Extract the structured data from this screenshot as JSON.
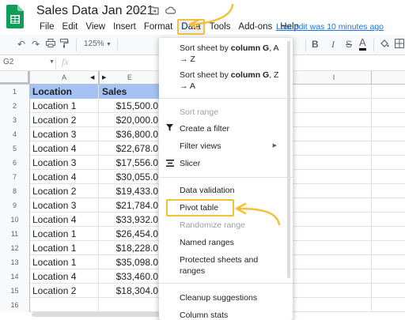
{
  "app": {
    "doc_title": "Sales Data Jan 2021",
    "last_edit": "Last edit was 10 minutes ago",
    "title_icons": [
      "star-icon",
      "move-to-folder-icon",
      "cloud-status-icon"
    ]
  },
  "menubar": {
    "items": [
      "File",
      "Edit",
      "View",
      "Insert",
      "Format",
      "Data",
      "Tools",
      "Add-ons",
      "Help"
    ],
    "active": "Data"
  },
  "toolbar": {
    "zoom": "125%",
    "bold": "B",
    "italic": "I",
    "strike": "S",
    "text_color": "A"
  },
  "formula_bar": {
    "name_box": "G2",
    "fx": "fx"
  },
  "grid": {
    "columns": [
      "A",
      "E",
      "I"
    ],
    "row_numbers": [
      "1",
      "2",
      "3",
      "4",
      "5",
      "6",
      "7",
      "8",
      "9",
      "10",
      "11",
      "12",
      "13",
      "14",
      "15",
      "16"
    ],
    "header": {
      "a": "Location",
      "e": "Sales"
    },
    "rows": [
      {
        "a": "Location 1",
        "e": "$15,500.0"
      },
      {
        "a": "Location 2",
        "e": "$20,000.0"
      },
      {
        "a": "Location 3",
        "e": "$36,800.0"
      },
      {
        "a": "Location 4",
        "e": "$22,678.0"
      },
      {
        "a": "Location 3",
        "e": "$17,556.0"
      },
      {
        "a": "Location 4",
        "e": "$30,055.0"
      },
      {
        "a": "Location 2",
        "e": "$19,433.0"
      },
      {
        "a": "Location 3",
        "e": "$21,784.0"
      },
      {
        "a": "Location 4",
        "e": "$33,932.0"
      },
      {
        "a": "Location 1",
        "e": "$26,454.0"
      },
      {
        "a": "Location 1",
        "e": "$18,228.0"
      },
      {
        "a": "Location 1",
        "e": "$35,098.0"
      },
      {
        "a": "Location 4",
        "e": "$33,460.0"
      },
      {
        "a": "Location 2",
        "e": "$18,304.0"
      }
    ],
    "header_fill": "#a4c2f4"
  },
  "data_menu": {
    "sort_az_pre": "Sort sheet by ",
    "sort_az_col": "column G",
    "sort_az_post": ", A",
    "sort_az_line2": "→ Z",
    "sort_za_pre": "Sort sheet by ",
    "sort_za_col": "column G",
    "sort_za_post": ", Z",
    "sort_za_line2": "→ A",
    "sort_range": "Sort range",
    "create_filter": "Create a filter",
    "filter_views": "Filter views",
    "slicer": "Slicer",
    "data_validation": "Data validation",
    "pivot_table": "Pivot table",
    "randomize_range": "Randomize range",
    "named_ranges": "Named ranges",
    "protected_line1": "Protected sheets and",
    "protected_line2": "ranges",
    "cleanup": "Cleanup suggestions",
    "column_stats": "Column stats"
  },
  "colors": {
    "highlight": "#f5c036",
    "link": "#1a73e8",
    "sheets_green": "#0f9d58"
  }
}
